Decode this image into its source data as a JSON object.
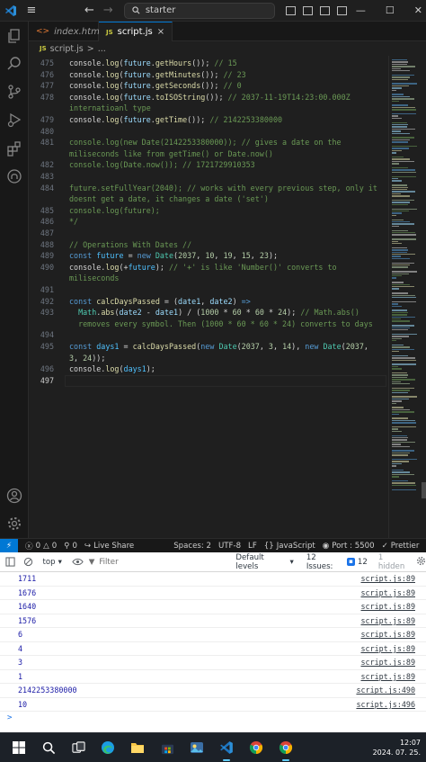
{
  "titlebar": {
    "search_text": "starter",
    "back_glyph": "←",
    "forward_glyph": "→",
    "minimize_glyph": "—",
    "maximize_glyph": "☐",
    "close_glyph": "✕"
  },
  "tabs": [
    {
      "label": "index.html",
      "badge": "<>"
    },
    {
      "label": "script.js",
      "badge": "JS",
      "close": "×"
    }
  ],
  "breadcrumb": {
    "badge": "JS",
    "file": "script.js",
    "sep": ">",
    "more": "..."
  },
  "editor": {
    "lines": [
      {
        "n": "475",
        "segs": [
          [
            "txt",
            "console."
          ],
          [
            "fn",
            "log"
          ],
          [
            "txt",
            "("
          ],
          [
            "prm",
            "future"
          ],
          [
            "txt",
            "."
          ],
          [
            "fn",
            "getHours"
          ],
          [
            "txt",
            "()); "
          ],
          [
            "com",
            "// 15"
          ]
        ]
      },
      {
        "n": "476",
        "segs": [
          [
            "txt",
            "console."
          ],
          [
            "fn",
            "log"
          ],
          [
            "txt",
            "("
          ],
          [
            "prm",
            "future"
          ],
          [
            "txt",
            "."
          ],
          [
            "fn",
            "getMinutes"
          ],
          [
            "txt",
            "()); "
          ],
          [
            "com",
            "// 23"
          ]
        ]
      },
      {
        "n": "477",
        "segs": [
          [
            "txt",
            "console."
          ],
          [
            "fn",
            "log"
          ],
          [
            "txt",
            "("
          ],
          [
            "prm",
            "future"
          ],
          [
            "txt",
            "."
          ],
          [
            "fn",
            "getSeconds"
          ],
          [
            "txt",
            "()); "
          ],
          [
            "com",
            "// 0"
          ]
        ]
      },
      {
        "n": "478",
        "segs": [
          [
            "txt",
            "console."
          ],
          [
            "fn",
            "log"
          ],
          [
            "txt",
            "("
          ],
          [
            "prm",
            "future"
          ],
          [
            "txt",
            "."
          ],
          [
            "fn",
            "toISOString"
          ],
          [
            "txt",
            "()); "
          ],
          [
            "com",
            "// 2037-11-19T14:23:00.000Z"
          ]
        ]
      },
      {
        "n": "",
        "segs": [
          [
            "com",
            "internatioanl type"
          ]
        ]
      },
      {
        "n": "479",
        "segs": [
          [
            "txt",
            "console."
          ],
          [
            "fn",
            "log"
          ],
          [
            "txt",
            "("
          ],
          [
            "prm",
            "future"
          ],
          [
            "txt",
            "."
          ],
          [
            "fn",
            "getTime"
          ],
          [
            "txt",
            "()); "
          ],
          [
            "com",
            "// 2142253380000"
          ]
        ]
      },
      {
        "n": "480",
        "segs": []
      },
      {
        "n": "481",
        "segs": [
          [
            "com",
            "console.log(new Date(2142253380000)); // gives a date on the"
          ]
        ]
      },
      {
        "n": "",
        "segs": [
          [
            "com",
            "miliseconds like from getTime() or Date.now()"
          ]
        ]
      },
      {
        "n": "482",
        "segs": [
          [
            "com",
            "console.log(Date.now()); // 1721729910353"
          ]
        ]
      },
      {
        "n": "483",
        "segs": []
      },
      {
        "n": "484",
        "segs": [
          [
            "com",
            "future.setFullYear(2040); // works with every previous step, only it"
          ]
        ]
      },
      {
        "n": "",
        "segs": [
          [
            "com",
            "doesnt get a date, it changes a date ('set')"
          ]
        ]
      },
      {
        "n": "485",
        "segs": [
          [
            "com",
            "console.log(future);"
          ]
        ]
      },
      {
        "n": "486",
        "segs": [
          [
            "com",
            "*/"
          ]
        ]
      },
      {
        "n": "487",
        "segs": []
      },
      {
        "n": "488",
        "segs": [
          [
            "com",
            "// Operations With Dates //"
          ]
        ]
      },
      {
        "n": "489",
        "segs": [
          [
            "kw",
            "const "
          ],
          [
            "var",
            "future"
          ],
          [
            "txt",
            " = "
          ],
          [
            "kw",
            "new "
          ],
          [
            "cls",
            "Date"
          ],
          [
            "txt",
            "("
          ],
          [
            "num",
            "2037"
          ],
          [
            "txt",
            ", "
          ],
          [
            "num",
            "10"
          ],
          [
            "txt",
            ", "
          ],
          [
            "num",
            "19"
          ],
          [
            "txt",
            ", "
          ],
          [
            "num",
            "15"
          ],
          [
            "txt",
            ", "
          ],
          [
            "num",
            "23"
          ],
          [
            "txt",
            ");"
          ]
        ]
      },
      {
        "n": "490",
        "segs": [
          [
            "txt",
            "console."
          ],
          [
            "fn",
            "log"
          ],
          [
            "txt",
            "(+"
          ],
          [
            "var",
            "future"
          ],
          [
            "txt",
            "); "
          ],
          [
            "com",
            "// '+' is like 'Number()' converts to"
          ]
        ]
      },
      {
        "n": "",
        "segs": [
          [
            "com",
            "miliseconds"
          ]
        ]
      },
      {
        "n": "491",
        "segs": []
      },
      {
        "n": "492",
        "segs": [
          [
            "kw",
            "const "
          ],
          [
            "fn",
            "calcDaysPassed"
          ],
          [
            "txt",
            " = ("
          ],
          [
            "prm",
            "date1"
          ],
          [
            "txt",
            ", "
          ],
          [
            "prm",
            "date2"
          ],
          [
            "txt",
            ") "
          ],
          [
            "kw",
            "=>"
          ]
        ]
      },
      {
        "n": "493",
        "segs": [
          [
            "txt",
            "  "
          ],
          [
            "cls",
            "Math"
          ],
          [
            "txt",
            "."
          ],
          [
            "fn",
            "abs"
          ],
          [
            "txt",
            "("
          ],
          [
            "prm",
            "date2"
          ],
          [
            "txt",
            " - "
          ],
          [
            "prm",
            "date1"
          ],
          [
            "txt",
            ") / ("
          ],
          [
            "num",
            "1000"
          ],
          [
            "txt",
            " * "
          ],
          [
            "num",
            "60"
          ],
          [
            "txt",
            " * "
          ],
          [
            "num",
            "60"
          ],
          [
            "txt",
            " * "
          ],
          [
            "num",
            "24"
          ],
          [
            "txt",
            "); "
          ],
          [
            "com",
            "// Math.abs()"
          ]
        ]
      },
      {
        "n": "",
        "segs": [
          [
            "com",
            "  removes every symbol. Then (1000 * 60 * 60 * 24) converts to days"
          ]
        ]
      },
      {
        "n": "494",
        "segs": []
      },
      {
        "n": "495",
        "segs": [
          [
            "kw",
            "const "
          ],
          [
            "var",
            "days1"
          ],
          [
            "txt",
            " = "
          ],
          [
            "fn",
            "calcDaysPassed"
          ],
          [
            "txt",
            "("
          ],
          [
            "kw",
            "new "
          ],
          [
            "cls",
            "Date"
          ],
          [
            "txt",
            "("
          ],
          [
            "num",
            "2037"
          ],
          [
            "txt",
            ", "
          ],
          [
            "num",
            "3"
          ],
          [
            "txt",
            ", "
          ],
          [
            "num",
            "14"
          ],
          [
            "txt",
            "), "
          ],
          [
            "kw",
            "new "
          ],
          [
            "cls",
            "Date"
          ],
          [
            "txt",
            "("
          ],
          [
            "num",
            "2037"
          ],
          [
            "txt",
            ","
          ]
        ]
      },
      {
        "n": "",
        "segs": [
          [
            "num",
            "3"
          ],
          [
            "txt",
            ", "
          ],
          [
            "num",
            "24"
          ],
          [
            "txt",
            "));"
          ]
        ]
      },
      {
        "n": "496",
        "segs": [
          [
            "txt",
            "console."
          ],
          [
            "fn",
            "log"
          ],
          [
            "txt",
            "("
          ],
          [
            "var",
            "days1"
          ],
          [
            "txt",
            ");"
          ]
        ]
      },
      {
        "n": "497",
        "segs": [],
        "current": true
      }
    ]
  },
  "statusbar": {
    "remote_glyph": "⚡",
    "errors": "0",
    "warnings": "0",
    "ports": "0",
    "live_share": "Live Share",
    "spaces": "Spaces: 2",
    "encoding": "UTF-8",
    "eol": "LF",
    "language": "JavaScript",
    "port": "Port : 5500",
    "prettier": "Prettier"
  },
  "console": {
    "context": "top",
    "filter_placeholder": "Filter",
    "levels": "Default levels",
    "issues_label": "12 Issues:",
    "issues_count": "12",
    "hidden": "1 hidden",
    "rows": [
      {
        "value": "1711",
        "src": "script.js:89"
      },
      {
        "value": "1676",
        "src": "script.js:89"
      },
      {
        "value": "1640",
        "src": "script.js:89"
      },
      {
        "value": "1576",
        "src": "script.js:89"
      },
      {
        "value": "6",
        "src": "script.js:89"
      },
      {
        "value": "4",
        "src": "script.js:89"
      },
      {
        "value": "3",
        "src": "script.js:89"
      },
      {
        "value": "1",
        "src": "script.js:89"
      },
      {
        "value": "2142253380000",
        "src": "script.js:490"
      },
      {
        "value": "10",
        "src": "script.js:496"
      }
    ],
    "prompt": ">"
  },
  "taskbar": {
    "time": "12:07",
    "date": "2024. 07. 25."
  },
  "colors": {
    "accent": "#0078d4",
    "comment": "#6a9955",
    "keyword": "#569cd6",
    "function": "#dcdcaa",
    "class": "#4ec9b0",
    "number": "#b5cea8"
  }
}
